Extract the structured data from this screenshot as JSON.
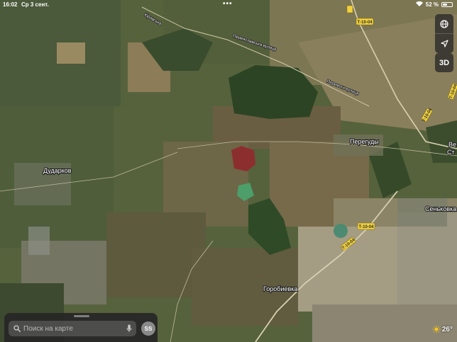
{
  "status_bar": {
    "time": "16:02",
    "date": "Ср 3 сент.",
    "battery_percent": "52 %",
    "battery_level": 0.52
  },
  "map": {
    "towns": [
      "Дударков",
      "Перегуды",
      "Горобиевка",
      "Сеньковка",
      "Ве",
      "Ст"
    ],
    "roads": [
      "Кіровська",
      "Переяславська вулиця",
      "Перемоги вулиця"
    ],
    "route_shields": [
      "Т-10-04",
      "Т-10-04",
      "Т-10-04",
      "Т-10-04",
      "Т-10-04"
    ]
  },
  "controls": {
    "globe_icon": "globe-icon",
    "location_icon": "location-arrow-icon",
    "view_3d": "3D"
  },
  "search": {
    "placeholder": "Поиск на карте",
    "mic_icon": "microphone-icon",
    "avatar_initials": "SS"
  },
  "weather": {
    "icon": "sun-icon",
    "temperature": "26°"
  },
  "colors": {
    "farmland": "#6b6a45",
    "forest": "#2c4424",
    "red_area": "#8c2e2e",
    "road": "#d8d0b0"
  }
}
